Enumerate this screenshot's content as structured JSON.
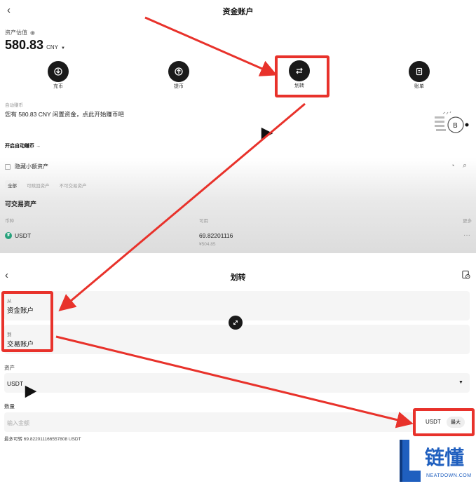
{
  "top": {
    "title": "资金账户",
    "assets_label": "资产估值",
    "balance": "580.83",
    "currency": "CNY",
    "actions": [
      {
        "label": "充币",
        "icon": "deposit-icon"
      },
      {
        "label": "提币",
        "icon": "withdraw-icon"
      },
      {
        "label": "划转",
        "icon": "transfer-icon"
      },
      {
        "label": "账单",
        "icon": "bill-icon"
      }
    ],
    "promo_caption": "自动赚币",
    "promo_text": "您有 580.83 CNY 闲置资金，点此开始赚币吧",
    "auto_earn": "开启自动赚币 →",
    "hide_small": "隐藏小额资产",
    "filters": [
      "全部",
      "可赎回资产",
      "不可交易资产"
    ],
    "section_title": "可交易资产",
    "table_headers": {
      "col1": "币种",
      "col2": "可用",
      "col3": "更多"
    },
    "asset_row": {
      "name": "USDT",
      "amount": "69.82201116",
      "fiat": "¥504.85"
    }
  },
  "bottom": {
    "title": "划转",
    "from_label": "从",
    "from_value": "资金账户",
    "to_label": "到",
    "to_value": "交易账户",
    "asset_label": "资产",
    "asset_value": "USDT",
    "amount_label": "数量",
    "amount_placeholder": "输入金额",
    "amount_unit": "USDT",
    "max_label": "最大",
    "available_text": "最多可转 69.8220111665578​08 USDT"
  },
  "watermark": {
    "cn": "链懂",
    "en": "NEATDOWN.COM"
  },
  "colors": {
    "annotation_red": "#e8322b",
    "dark": "#1a1a1a",
    "logo_blue": "#1f5fbf"
  }
}
